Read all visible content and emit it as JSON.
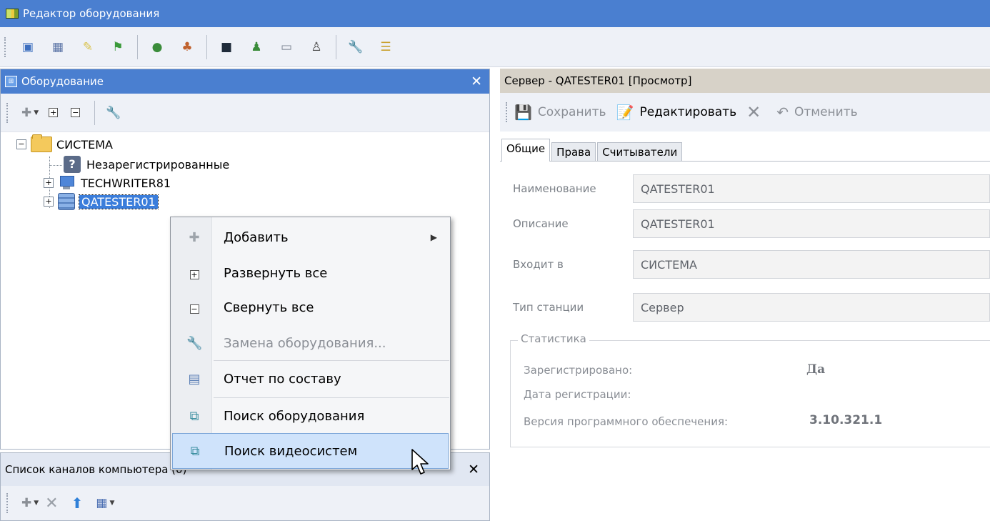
{
  "window": {
    "title": "Редактор оборудования"
  },
  "equipment_panel": {
    "title": "Оборудование",
    "tree": {
      "root": "СИСТЕМА",
      "children": [
        "Незарегистрированные",
        "TECHWRITER81",
        "QATESTER01"
      ]
    }
  },
  "channels_panel": {
    "title": "Список каналов компьютера (0)"
  },
  "context_menu": {
    "items": [
      {
        "label": "Добавить",
        "icon": "plus-icon",
        "submenu": true
      },
      {
        "label": "Развернуть все",
        "icon": "expand-box-icon"
      },
      {
        "label": "Свернуть все",
        "icon": "collapse-box-icon"
      },
      {
        "label": "Замена оборудования...",
        "icon": "wrench-icon",
        "disabled": true
      },
      {
        "label": "Отчет по составу",
        "icon": "report-icon"
      },
      {
        "label": "Поиск оборудования",
        "icon": "search-equipment-icon"
      },
      {
        "label": "Поиск видеосистем",
        "icon": "search-video-icon",
        "hover": true
      }
    ]
  },
  "detail_panel": {
    "title": "Сервер - QATESTER01 [Просмотр]",
    "toolbar": {
      "save": "Сохранить",
      "edit": "Редактировать",
      "cancel": "Отменить"
    },
    "tabs": [
      "Общие",
      "Права",
      "Считыватели"
    ],
    "fields": [
      {
        "label": "Наименование",
        "value": "QATESTER01"
      },
      {
        "label": "Описание",
        "value": "QATESTER01"
      },
      {
        "label": "Входит в",
        "value": "СИСТЕМА"
      },
      {
        "label": "Тип станции",
        "value": "Сервер"
      }
    ],
    "statistics": {
      "title": "Статистика",
      "registered_label": "Зарегистрировано:",
      "registered_value": "Да",
      "reg_date_label": "Дата регистрации:",
      "version_label": "Версия программного обеспечения:",
      "version_value": "3.10.321.1"
    }
  },
  "colors": {
    "accent": "#4a7fd0",
    "selection": "#3a7ddb",
    "menu_hover": "#cfe3fb"
  }
}
